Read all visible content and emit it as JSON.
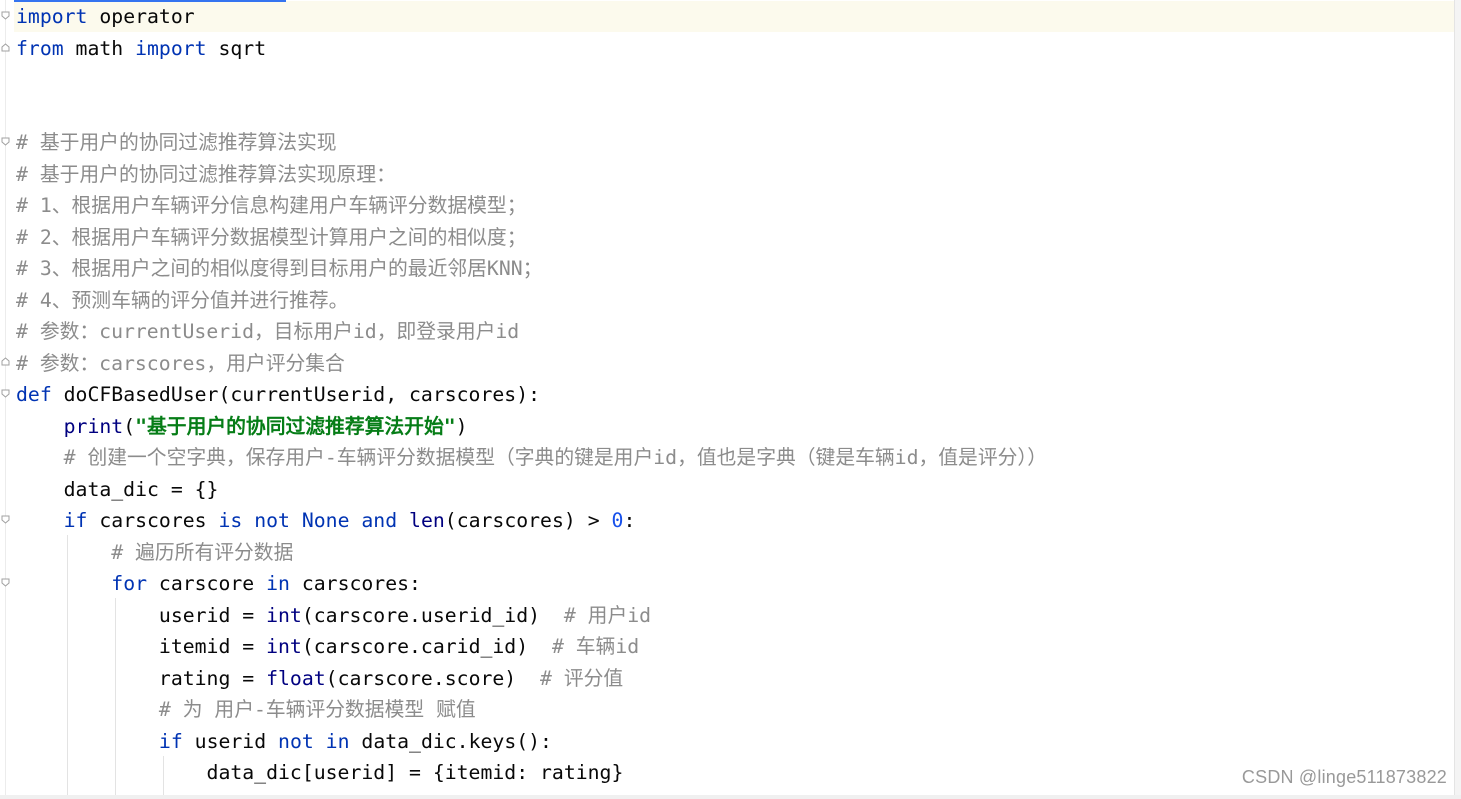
{
  "code_lines": [
    [
      {
        "t": "import",
        "c": "kw"
      },
      {
        "t": " operator",
        "c": ""
      }
    ],
    [
      {
        "t": "from",
        "c": "kw"
      },
      {
        "t": " math ",
        "c": ""
      },
      {
        "t": "import",
        "c": "kw"
      },
      {
        "t": " sqrt",
        "c": ""
      }
    ],
    [],
    [],
    [
      {
        "t": "# 基于用户的协同过滤推荐算法实现",
        "c": "cm"
      }
    ],
    [
      {
        "t": "# 基于用户的协同过滤推荐算法实现原理：",
        "c": "cm"
      }
    ],
    [
      {
        "t": "# 1、根据用户车辆评分信息构建用户车辆评分数据模型；",
        "c": "cm"
      }
    ],
    [
      {
        "t": "# 2、根据用户车辆评分数据模型计算用户之间的相似度；",
        "c": "cm"
      }
    ],
    [
      {
        "t": "# 3、根据用户之间的相似度得到目标用户的最近邻居KNN；",
        "c": "cm"
      }
    ],
    [
      {
        "t": "# 4、预测车辆的评分值并进行推荐。",
        "c": "cm"
      }
    ],
    [
      {
        "t": "# 参数：currentUserid，目标用户id，即登录用户id",
        "c": "cm"
      }
    ],
    [
      {
        "t": "# 参数：carscores，用户评分集合",
        "c": "cm"
      }
    ],
    [
      {
        "t": "def",
        "c": "kw"
      },
      {
        "t": " doCFBasedUser(currentUserid, carscores):",
        "c": ""
      }
    ],
    [
      {
        "t": "    ",
        "c": ""
      },
      {
        "t": "print",
        "c": "bi"
      },
      {
        "t": "(",
        "c": ""
      },
      {
        "t": "\"基于用户的协同过滤推荐算法开始\"",
        "c": "str"
      },
      {
        "t": ")",
        "c": ""
      }
    ],
    [
      {
        "t": "    ",
        "c": ""
      },
      {
        "t": "# 创建一个空字典，保存用户-车辆评分数据模型（字典的键是用户id，值也是字典（键是车辆id，值是评分））",
        "c": "cm"
      }
    ],
    [
      {
        "t": "    data_dic = {}",
        "c": ""
      }
    ],
    [
      {
        "t": "    ",
        "c": ""
      },
      {
        "t": "if",
        "c": "kw"
      },
      {
        "t": " carscores ",
        "c": ""
      },
      {
        "t": "is not None and",
        "c": "kw"
      },
      {
        "t": " ",
        "c": ""
      },
      {
        "t": "len",
        "c": "bi"
      },
      {
        "t": "(carscores) > ",
        "c": ""
      },
      {
        "t": "0",
        "c": "num"
      },
      {
        "t": ":",
        "c": ""
      }
    ],
    [
      {
        "t": "        ",
        "c": ""
      },
      {
        "t": "# 遍历所有评分数据",
        "c": "cm"
      }
    ],
    [
      {
        "t": "        ",
        "c": ""
      },
      {
        "t": "for",
        "c": "kw"
      },
      {
        "t": " carscore ",
        "c": ""
      },
      {
        "t": "in",
        "c": "kw"
      },
      {
        "t": " carscores:",
        "c": ""
      }
    ],
    [
      {
        "t": "            userid = ",
        "c": ""
      },
      {
        "t": "int",
        "c": "bi"
      },
      {
        "t": "(carscore.userid_id)  ",
        "c": ""
      },
      {
        "t": "# 用户id",
        "c": "cm"
      }
    ],
    [
      {
        "t": "            itemid = ",
        "c": ""
      },
      {
        "t": "int",
        "c": "bi"
      },
      {
        "t": "(carscore.carid_id)  ",
        "c": ""
      },
      {
        "t": "# 车辆id",
        "c": "cm"
      }
    ],
    [
      {
        "t": "            rating = ",
        "c": ""
      },
      {
        "t": "float",
        "c": "bi"
      },
      {
        "t": "(carscore.score)  ",
        "c": ""
      },
      {
        "t": "# 评分值",
        "c": "cm"
      }
    ],
    [
      {
        "t": "            ",
        "c": ""
      },
      {
        "t": "# 为 用户-车辆评分数据模型 赋值",
        "c": "cm"
      }
    ],
    [
      {
        "t": "            ",
        "c": ""
      },
      {
        "t": "if",
        "c": "kw"
      },
      {
        "t": " userid ",
        "c": ""
      },
      {
        "t": "not in",
        "c": "kw"
      },
      {
        "t": " data_dic.keys():",
        "c": ""
      }
    ],
    [
      {
        "t": "                data_dic[userid] = {itemid: rating}",
        "c": ""
      }
    ]
  ],
  "watermark": "CSDN @linge511873822",
  "colors": {
    "keyword": "#0033b3",
    "builtin": "#000080",
    "number": "#1750eb",
    "comment": "#8c8c8c",
    "string": "#067d17",
    "current_line": "#fcfaed"
  },
  "icons": [
    "fold-start-icon",
    "fold-end-icon"
  ]
}
